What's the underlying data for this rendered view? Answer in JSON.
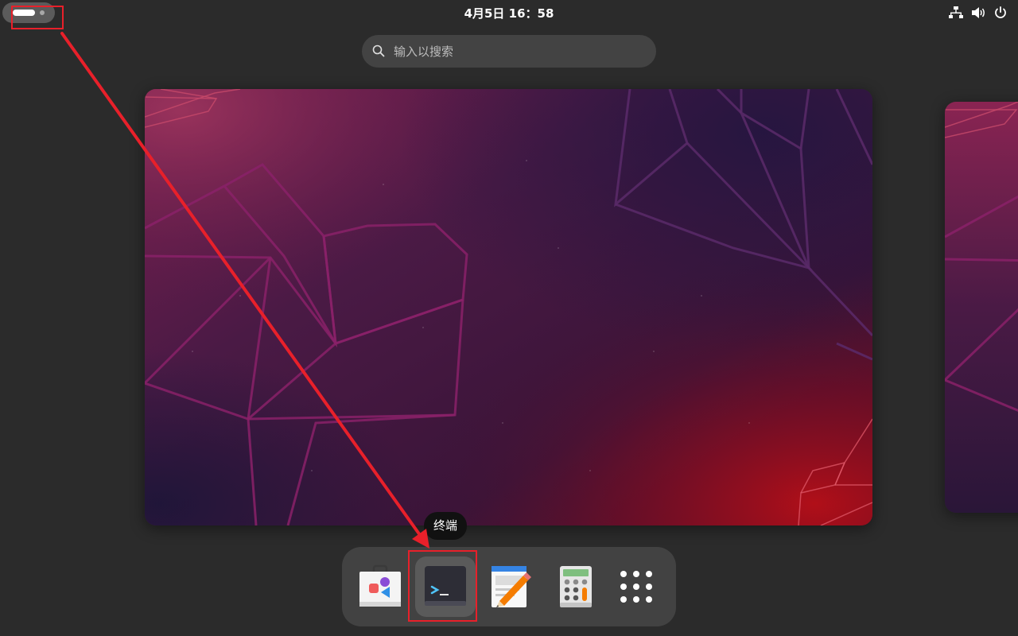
{
  "topbar": {
    "clock": "4月5日 16：58",
    "tray_icons": [
      "network-wired-icon",
      "volume-icon",
      "power-icon"
    ]
  },
  "search": {
    "placeholder": "输入以搜索",
    "value": ""
  },
  "dash": {
    "tooltip": "终端",
    "apps": [
      "software-store-icon",
      "terminal-icon",
      "text-editor-icon",
      "calculator-icon",
      "app-grid-icon"
    ]
  },
  "colors": {
    "annotation_red": "#e8202a",
    "panel": "#424242",
    "background": "#2b2b2b"
  }
}
